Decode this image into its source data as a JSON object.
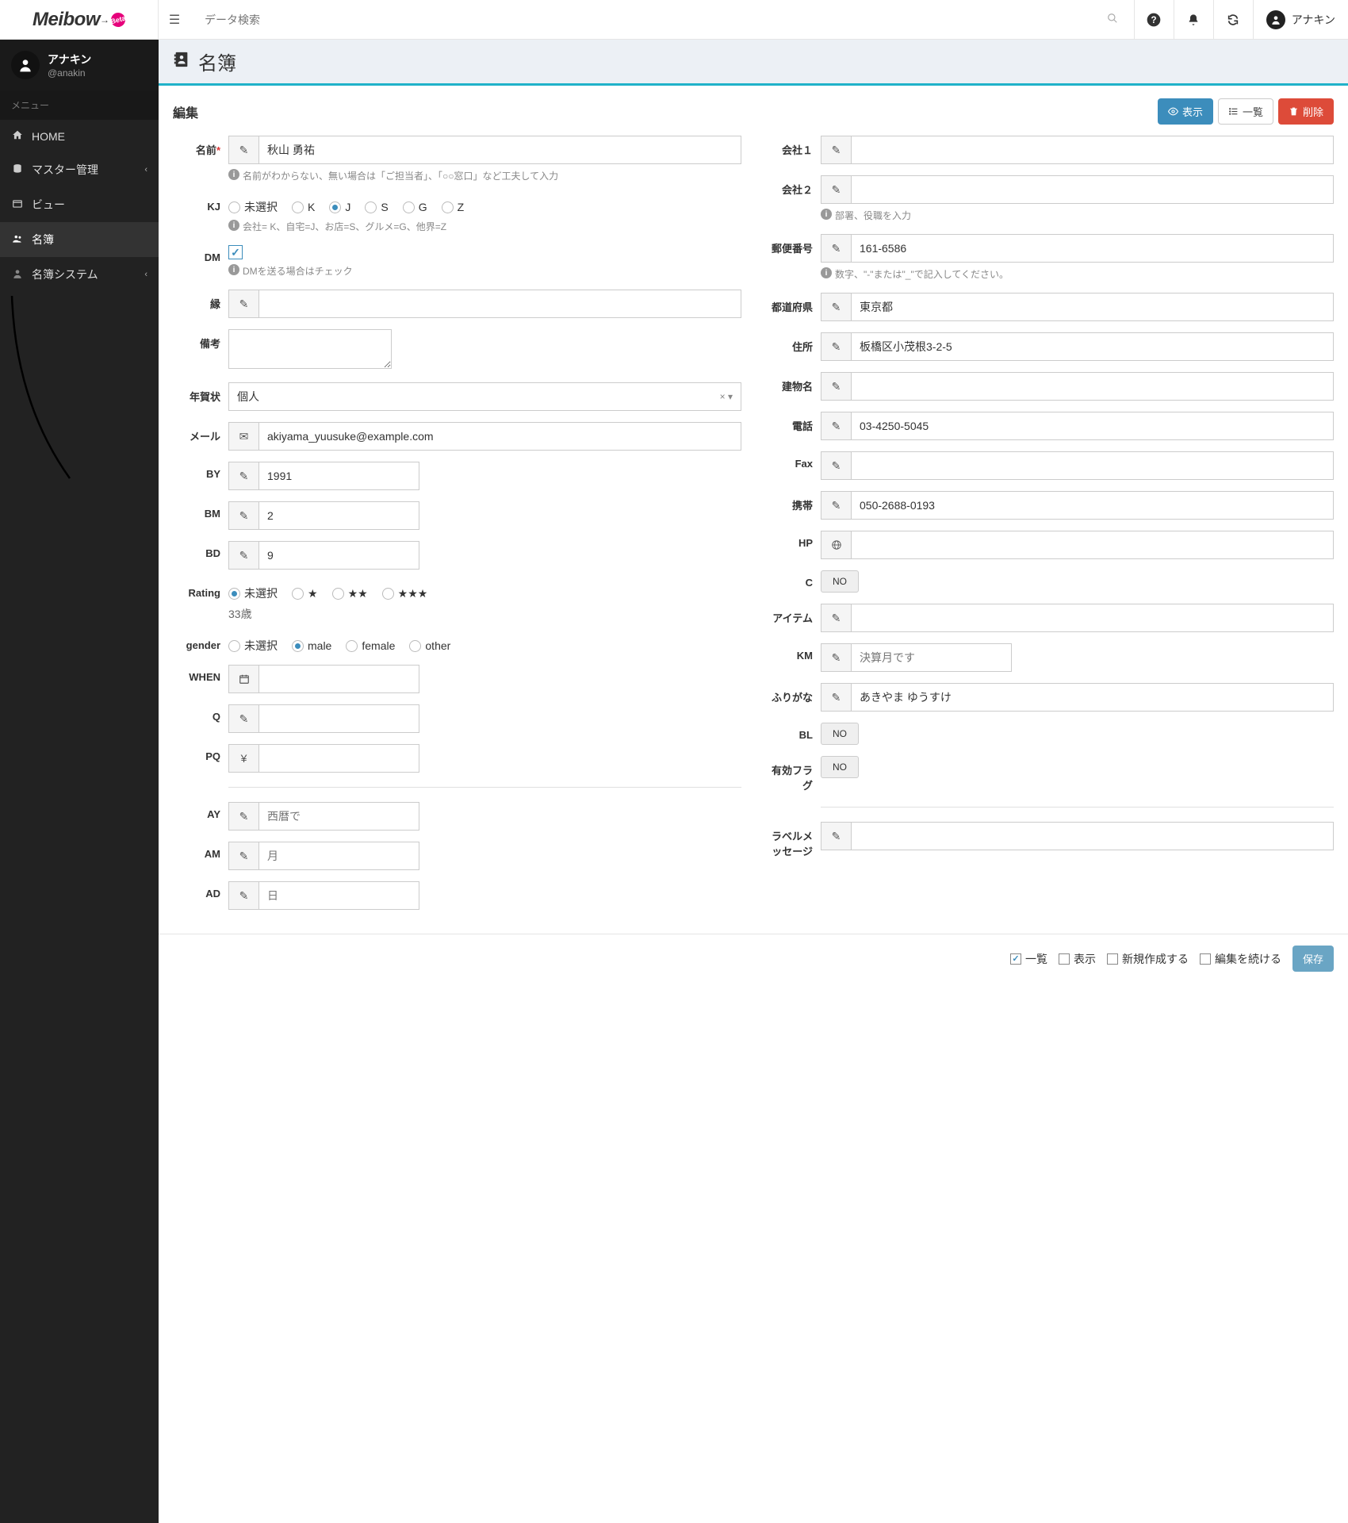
{
  "brand": {
    "name": "Meibow",
    "badge": "Beta"
  },
  "topbar": {
    "search_placeholder": "データ検索",
    "user_name": "アナキン"
  },
  "sidebar": {
    "user_name": "アナキン",
    "user_handle": "@anakin",
    "section": "メニュー",
    "items": [
      {
        "icon": "home",
        "label": "HOME"
      },
      {
        "icon": "db",
        "label": "マスター管理",
        "expandable": true
      },
      {
        "icon": "view",
        "label": "ビュー"
      },
      {
        "icon": "users",
        "label": "名簿",
        "active": true
      },
      {
        "icon": "user",
        "label": "名簿システム",
        "expandable": true
      }
    ]
  },
  "page": {
    "title": "名簿",
    "card_title": "編集",
    "buttons": {
      "show": "表示",
      "list": "一覧",
      "delete": "削除"
    }
  },
  "labels": {
    "name": "名前",
    "kj": "KJ",
    "dm": "DM",
    "en": "縁",
    "memo": "備考",
    "nenga": "年賀状",
    "mail": "メール",
    "by": "BY",
    "bm": "BM",
    "bd": "BD",
    "rating": "Rating",
    "gender": "gender",
    "when": "WHEN",
    "q": "Q",
    "pq": "PQ",
    "ay": "AY",
    "am": "AM",
    "ad": "AD",
    "company1": "会社１",
    "company2": "会社２",
    "zip": "郵便番号",
    "pref": "都道府県",
    "addr": "住所",
    "building": "建物名",
    "tel": "電話",
    "fax": "Fax",
    "mobile": "携帯",
    "hp": "HP",
    "c": "C",
    "item": "アイテム",
    "km": "KM",
    "furigana": "ふりがな",
    "bl": "BL",
    "valid": "有効フラグ",
    "label_msg": "ラベルメッセージ"
  },
  "values": {
    "name": "秋山 勇祐",
    "kj": "J",
    "dm": true,
    "nenga": "個人",
    "mail": "akiyama_yuusuke@example.com",
    "by": "1991",
    "bm": "2",
    "bd": "9",
    "rating": "未選択",
    "gender": "male",
    "age": "33歳",
    "company1": "",
    "company2": "",
    "zip": "161-6586",
    "pref": "東京都",
    "addr": "板橋区小茂根3-2-5",
    "building": "",
    "tel": "03-4250-5045",
    "fax": "",
    "mobile": "050-2688-0193",
    "hp": "",
    "c": "NO",
    "item": "",
    "km_placeholder": "決算月です",
    "furigana": "あきやま ゆうすけ",
    "bl": "NO",
    "valid": "NO",
    "label_msg": "",
    "ay_placeholder": "西暦で",
    "am_placeholder": "月",
    "ad_placeholder": "日"
  },
  "options": {
    "kj": [
      "未選択",
      "K",
      "J",
      "S",
      "G",
      "Z"
    ],
    "rating": [
      "未選択",
      "★",
      "★★",
      "★★★"
    ],
    "gender": [
      "未選択",
      "male",
      "female",
      "other"
    ]
  },
  "hints": {
    "name": "名前がわからない、無い場合は「ご担当者」、「○○窓口」など工夫して入力",
    "kj": "会社= K、自宅=J、お店=S、グルメ=G、他界=Z",
    "dm": "DMを送る場合はチェック",
    "company2": "部署、役職を入力",
    "zip": "数字、\"-\"または\"_\"で記入してください。"
  },
  "footer": {
    "list": "一覧",
    "show": "表示",
    "create": "新規作成する",
    "continue": "編集を続ける",
    "save": "保存"
  }
}
